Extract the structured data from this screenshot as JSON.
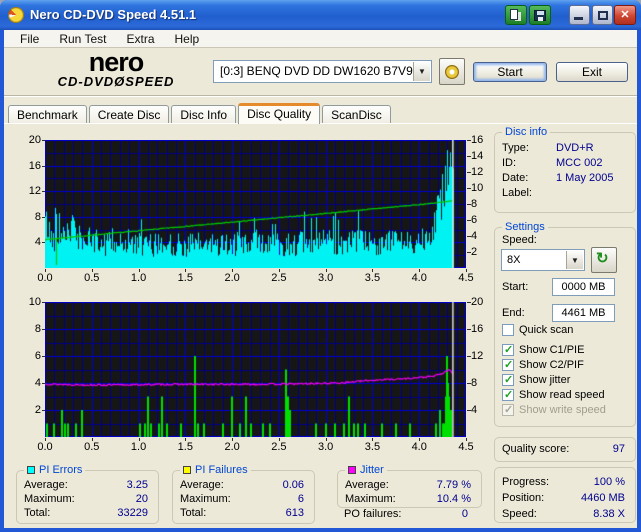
{
  "window": {
    "title": "Nero CD-DVD Speed 4.51.1"
  },
  "menu": {
    "items": [
      "File",
      "Run Test",
      "Extra",
      "Help"
    ]
  },
  "header": {
    "logo_line1": "nero",
    "logo_line2": "CD-DVDØSPEED",
    "drive_select": "[0:3]   BENQ DVD DD DW1620 B7V9",
    "start_label": "Start",
    "exit_label": "Exit"
  },
  "tabs": {
    "items": [
      {
        "label": "Benchmark",
        "active": false
      },
      {
        "label": "Create Disc",
        "active": false
      },
      {
        "label": "Disc Info",
        "active": false
      },
      {
        "label": "Disc Quality",
        "active": true
      },
      {
        "label": "ScanDisc",
        "active": false
      }
    ]
  },
  "disc_info": {
    "title": "Disc info",
    "rows": [
      {
        "label": "Type:",
        "value": "DVD+R"
      },
      {
        "label": "ID:",
        "value": "MCC 002"
      },
      {
        "label": "Date:",
        "value": "1 May 2005"
      },
      {
        "label": "Label:",
        "value": ""
      }
    ]
  },
  "settings": {
    "title": "Settings",
    "speed_label": "Speed:",
    "speed_value": "8X",
    "start_label": "Start:",
    "start_value": "0000 MB",
    "end_label": "End:",
    "end_value": "4461 MB",
    "checkboxes": [
      {
        "label": "Quick scan",
        "checked": false,
        "enabled": true
      },
      {
        "label": "Show C1/PIE",
        "checked": true,
        "enabled": true
      },
      {
        "label": "Show C2/PIF",
        "checked": true,
        "enabled": true
      },
      {
        "label": "Show jitter",
        "checked": true,
        "enabled": true
      },
      {
        "label": "Show read speed",
        "checked": true,
        "enabled": true
      },
      {
        "label": "Show write speed",
        "checked": true,
        "enabled": false
      }
    ]
  },
  "quality": {
    "label": "Quality score:",
    "value": "97"
  },
  "progress": {
    "rows": [
      {
        "label": "Progress:",
        "value": "100 %"
      },
      {
        "label": "Position:",
        "value": "4460 MB"
      },
      {
        "label": "Speed:",
        "value": "8.38 X"
      }
    ]
  },
  "stats": {
    "pi_errors": {
      "title": "PI Errors",
      "color": "#00FFFF",
      "rows": [
        {
          "label": "Average:",
          "value": "3.25"
        },
        {
          "label": "Maximum:",
          "value": "20"
        },
        {
          "label": "Total:",
          "value": "33229"
        }
      ]
    },
    "pi_failures": {
      "title": "PI Failures",
      "color": "#FFFF00",
      "rows": [
        {
          "label": "Average:",
          "value": "0.06"
        },
        {
          "label": "Maximum:",
          "value": "6"
        },
        {
          "label": "Total:",
          "value": "613"
        }
      ]
    },
    "jitter": {
      "title": "Jitter",
      "color": "#FF00FF",
      "rows": [
        {
          "label": "Average:",
          "value": "7.79 %"
        },
        {
          "label": "Maximum:",
          "value": "10.4 %"
        }
      ],
      "po_label": "PO failures:",
      "po_value": "0"
    }
  },
  "chart_data": [
    {
      "type": "area",
      "name": "PI Errors / Read speed scan",
      "x": {
        "min": 0,
        "max": 4.5,
        "minor": 0.1,
        "major": 0.5,
        "tick_labels": [
          "0.0",
          "0.5",
          "1.0",
          "1.5",
          "2.0",
          "2.5",
          "3.0",
          "3.5",
          "4.0",
          "4.5"
        ]
      },
      "y_left": {
        "min": 0,
        "max": 20,
        "minor": 2,
        "major": 4,
        "ticks": [
          4,
          8,
          12,
          16,
          20
        ]
      },
      "y_right": {
        "min": 0,
        "max": 16,
        "ticks": [
          2,
          4,
          6,
          8,
          10,
          12,
          14,
          16
        ]
      },
      "grid": {
        "bg": "#161616",
        "minor": "#000088",
        "major": "#0000D8",
        "marker": "#DCDCDC"
      },
      "data_end_x": 4.36,
      "marker_x": 4.36,
      "series": [
        {
          "name": "PI Errors",
          "type": "noisy-area",
          "axis": "left",
          "color": "#00F2F2",
          "noise": 1.7,
          "seed": 42,
          "points": [
            [
              0,
              7.5
            ],
            [
              0.03,
              6
            ],
            [
              0.07,
              4.5
            ],
            [
              0.12,
              5
            ],
            [
              0.16,
              5.5
            ],
            [
              0.2,
              5.5
            ],
            [
              0.25,
              6
            ],
            [
              0.28,
              6.5
            ],
            [
              0.32,
              5
            ],
            [
              0.4,
              4.5
            ],
            [
              0.5,
              4.2
            ],
            [
              0.65,
              3.8
            ],
            [
              0.8,
              3.8
            ],
            [
              1.0,
              3.6
            ],
            [
              1.25,
              3.6
            ],
            [
              1.5,
              3.6
            ],
            [
              1.75,
              3.7
            ],
            [
              2.0,
              3.7
            ],
            [
              2.25,
              3.8
            ],
            [
              2.5,
              3.8
            ],
            [
              2.75,
              3.8
            ],
            [
              3.0,
              4.0
            ],
            [
              3.25,
              3.9
            ],
            [
              3.5,
              4.0
            ],
            [
              3.75,
              4.0
            ],
            [
              3.95,
              4.2
            ],
            [
              4.05,
              4.8
            ],
            [
              4.12,
              6
            ],
            [
              4.18,
              8
            ],
            [
              4.22,
              10
            ],
            [
              4.26,
              13
            ],
            [
              4.3,
              17
            ],
            [
              4.33,
              19.5
            ],
            [
              4.36,
              15
            ]
          ]
        },
        {
          "name": "Read speed",
          "type": "noisy-line",
          "axis": "right",
          "color": "#00CC00",
          "noise": 0.05,
          "seed": 7,
          "dip_x": 0.12,
          "points": [
            [
              0,
              3.55
            ],
            [
              0.5,
              4.1
            ],
            [
              1.0,
              4.65
            ],
            [
              1.5,
              5.2
            ],
            [
              2.0,
              5.72
            ],
            [
              2.5,
              6.28
            ],
            [
              3.0,
              6.82
            ],
            [
              3.5,
              7.38
            ],
            [
              4.0,
              7.92
            ],
            [
              4.3,
              8.3
            ],
            [
              4.36,
              8.38
            ]
          ]
        }
      ]
    },
    {
      "type": "bar",
      "name": "PI Failures / Jitter scan",
      "x": {
        "min": 0,
        "max": 4.5,
        "minor": 0.1,
        "major": 0.5,
        "tick_labels": [
          "0.0",
          "0.5",
          "1.0",
          "1.5",
          "2.0",
          "2.5",
          "3.0",
          "3.5",
          "4.0",
          "4.5"
        ]
      },
      "y_left": {
        "min": 0,
        "max": 10,
        "minor": 1,
        "major": 2,
        "ticks": [
          2,
          4,
          6,
          8,
          10
        ]
      },
      "y_right": {
        "min": 0,
        "max": 20,
        "ticks": [
          4,
          8,
          12,
          16,
          20
        ]
      },
      "grid": {
        "bg": "#161616",
        "minor": "#000088",
        "major": "#0000D8",
        "marker": "#DCDCDC"
      },
      "data_end_x": 4.36,
      "marker_x": 4.36,
      "series": [
        {
          "name": "PI Failures",
          "type": "bars",
          "axis": "left",
          "color": "#00E000",
          "bars": [
            [
              0.02,
              1
            ],
            [
              0.1,
              1
            ],
            [
              0.18,
              2
            ],
            [
              0.21,
              1
            ],
            [
              0.25,
              1
            ],
            [
              0.33,
              1
            ],
            [
              0.4,
              2
            ],
            [
              1.02,
              1
            ],
            [
              1.07,
              1
            ],
            [
              1.1,
              3
            ],
            [
              1.13,
              1
            ],
            [
              1.22,
              1
            ],
            [
              1.25,
              3
            ],
            [
              1.3,
              1
            ],
            [
              1.45,
              1
            ],
            [
              1.6,
              6
            ],
            [
              1.64,
              1
            ],
            [
              1.7,
              1
            ],
            [
              1.9,
              1
            ],
            [
              2.0,
              3
            ],
            [
              2.08,
              1
            ],
            [
              2.15,
              3
            ],
            [
              2.2,
              1
            ],
            [
              2.33,
              1
            ],
            [
              2.4,
              1
            ],
            [
              2.58,
              5
            ],
            [
              2.6,
              3
            ],
            [
              2.62,
              2
            ],
            [
              2.9,
              1
            ],
            [
              3.0,
              1
            ],
            [
              3.1,
              1
            ],
            [
              3.2,
              1
            ],
            [
              3.25,
              3
            ],
            [
              3.3,
              1
            ],
            [
              3.35,
              1
            ],
            [
              3.42,
              1
            ],
            [
              3.6,
              1
            ],
            [
              3.75,
              1
            ],
            [
              3.9,
              1
            ],
            [
              4.18,
              1
            ],
            [
              4.22,
              2
            ],
            [
              4.25,
              1
            ],
            [
              4.27,
              1
            ],
            [
              4.29,
              3
            ],
            [
              4.3,
              6
            ],
            [
              4.31,
              4
            ],
            [
              4.32,
              3
            ],
            [
              4.34,
              2
            ]
          ]
        },
        {
          "name": "Jitter",
          "type": "noisy-line",
          "axis": "right",
          "color": "#F000F0",
          "noise": 0.12,
          "seed": 13,
          "points": [
            [
              0,
              7.85
            ],
            [
              0.3,
              7.75
            ],
            [
              0.6,
              7.7
            ],
            [
              1.0,
              7.75
            ],
            [
              1.4,
              7.8
            ],
            [
              1.8,
              7.8
            ],
            [
              2.2,
              7.8
            ],
            [
              2.6,
              7.85
            ],
            [
              3.0,
              7.95
            ],
            [
              3.2,
              8.05
            ],
            [
              3.4,
              8.3
            ],
            [
              3.6,
              8.5
            ],
            [
              3.8,
              8.6
            ],
            [
              4.0,
              8.8
            ],
            [
              4.15,
              9.0
            ],
            [
              4.25,
              9.4
            ],
            [
              4.32,
              10.0
            ],
            [
              4.36,
              9.3
            ]
          ]
        }
      ]
    }
  ]
}
